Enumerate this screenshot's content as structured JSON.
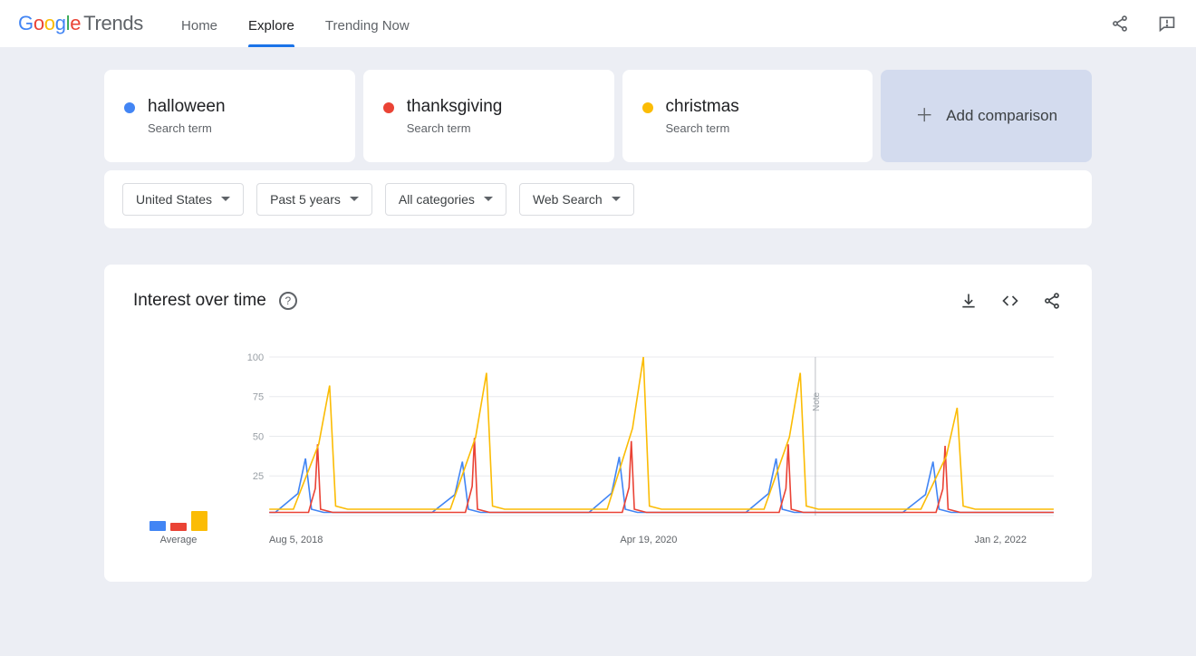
{
  "header": {
    "logo_trends": "Trends",
    "nav": {
      "home": "Home",
      "explore": "Explore",
      "trending": "Trending Now"
    }
  },
  "compare": {
    "terms": [
      {
        "name": "halloween",
        "type": "Search term",
        "color": "#4285F4"
      },
      {
        "name": "thanksgiving",
        "type": "Search term",
        "color": "#EA4335"
      },
      {
        "name": "christmas",
        "type": "Search term",
        "color": "#FBBC05"
      }
    ],
    "add_label": "Add comparison"
  },
  "filters": {
    "geo": "United States",
    "time": "Past 5 years",
    "category": "All categories",
    "search_type": "Web Search"
  },
  "chart": {
    "title": "Interest over time",
    "average_label": "Average",
    "x_ticks": [
      "Aug 5, 2018",
      "Apr 19, 2020",
      "Jan 2, 2022"
    ],
    "note_label": "Note"
  },
  "chart_data": {
    "type": "line",
    "title": "Interest over time",
    "xlabel": "",
    "ylabel": "",
    "ylim": [
      0,
      100
    ],
    "y_ticks": [
      25,
      50,
      75,
      100
    ],
    "x_tick_labels": [
      "Aug 5, 2018",
      "Apr 19, 2020",
      "Jan 2, 2022"
    ],
    "x_range_weeks": 260,
    "averages": {
      "halloween": 5,
      "thanksgiving": 4,
      "christmas": 10
    },
    "note_marker_x": 181,
    "series": [
      {
        "name": "halloween",
        "color": "#4285F4",
        "peaks": [
          {
            "x": 12,
            "value": 36
          },
          {
            "x": 64,
            "value": 34
          },
          {
            "x": 116,
            "value": 37
          },
          {
            "x": 168,
            "value": 36
          },
          {
            "x": 220,
            "value": 34
          }
        ],
        "baseline": 2,
        "ramp_width": 10,
        "fall_width": 2
      },
      {
        "name": "thanksgiving",
        "color": "#EA4335",
        "peaks": [
          {
            "x": 16,
            "value": 45
          },
          {
            "x": 68,
            "value": 49
          },
          {
            "x": 120,
            "value": 47
          },
          {
            "x": 172,
            "value": 45
          },
          {
            "x": 224,
            "value": 44
          }
        ],
        "baseline": 2,
        "ramp_width": 3,
        "fall_width": 1
      },
      {
        "name": "christmas",
        "color": "#FBBC05",
        "peaks": [
          {
            "x": 20,
            "value": 82
          },
          {
            "x": 72,
            "value": 90
          },
          {
            "x": 124,
            "value": 100
          },
          {
            "x": 176,
            "value": 90
          },
          {
            "x": 228,
            "value": 68
          }
        ],
        "baseline": 4,
        "ramp_width": 12,
        "fall_width": 2,
        "shoulder": 0.55
      }
    ]
  }
}
